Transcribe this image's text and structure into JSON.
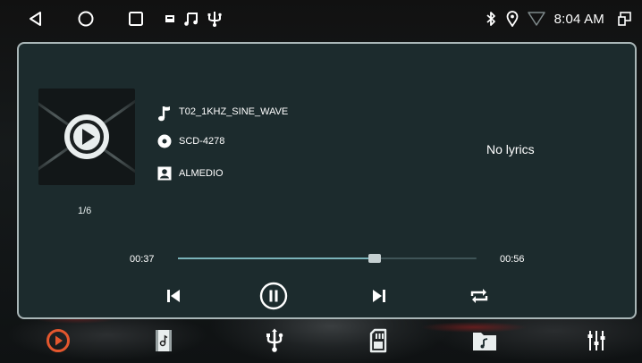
{
  "status_bar": {
    "nav_icons": [
      "back-triangle-icon",
      "home-circle-icon",
      "recents-square-icon"
    ],
    "notification_icons": [
      "card-icon",
      "music-note-icon",
      "usb-icon"
    ],
    "status_icons": [
      "bluetooth-icon",
      "location-pin-icon",
      "signal-triangle-icon"
    ],
    "time": "8:04 AM",
    "end_icon": "screen-mirror-icon"
  },
  "player": {
    "track_counter": "1/6",
    "title": "T02_1KHZ_SINE_WAVE",
    "album": "SCD-4278",
    "artist": "ALMEDIO",
    "lyrics": "No lyrics",
    "current_time": "00:37",
    "total_time": "00:56",
    "progress": 0.66
  },
  "controls": [
    "previous-icon",
    "pause-icon",
    "next-icon",
    "repeat-icon"
  ],
  "dock": [
    "play-circle-icon",
    "video-file-icon",
    "usb-icon",
    "sd-card-icon",
    "music-folder-icon",
    "equalizer-icon"
  ],
  "colors": {
    "card_bg": "#1c2b2d",
    "card_border": "#a9b6b7",
    "accent": "#e4572e",
    "progress_fill": "#7ab3b9"
  }
}
